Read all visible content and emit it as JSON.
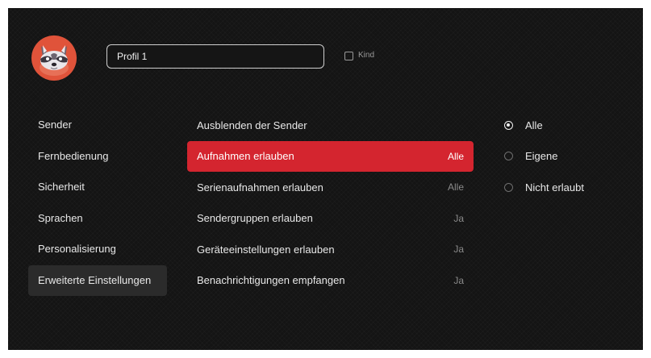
{
  "profile": {
    "avatar_icon": "raccoon-avatar",
    "avatar_color": "#e0533a",
    "name_value": "Profil 1",
    "kind_label": "Kind",
    "kind_checked": false
  },
  "nav": {
    "items": [
      {
        "label": "Sender"
      },
      {
        "label": "Fernbedienung"
      },
      {
        "label": "Sicherheit"
      },
      {
        "label": "Sprachen"
      },
      {
        "label": "Personalisierung"
      },
      {
        "label": "Erweiterte Einstellungen",
        "active": true
      }
    ]
  },
  "settings": {
    "rows": [
      {
        "label": "Ausblenden der Sender",
        "value": ""
      },
      {
        "label": "Aufnahmen erlauben",
        "value": "Alle",
        "selected": true
      },
      {
        "label": "Serienaufnahmen erlauben",
        "value": "Alle"
      },
      {
        "label": "Sendergruppen erlauben",
        "value": "Ja"
      },
      {
        "label": "Geräteeinstellungen erlauben",
        "value": "Ja"
      },
      {
        "label": "Benachrichtigungen empfangen",
        "value": "Ja"
      }
    ]
  },
  "options": {
    "items": [
      {
        "label": "Alle",
        "checked": true
      },
      {
        "label": "Eigene",
        "checked": false
      },
      {
        "label": "Nicht erlaubt",
        "checked": false
      }
    ]
  },
  "colors": {
    "accent": "#d4252f",
    "background": "#141414",
    "active_nav": "#2b2b2b"
  }
}
